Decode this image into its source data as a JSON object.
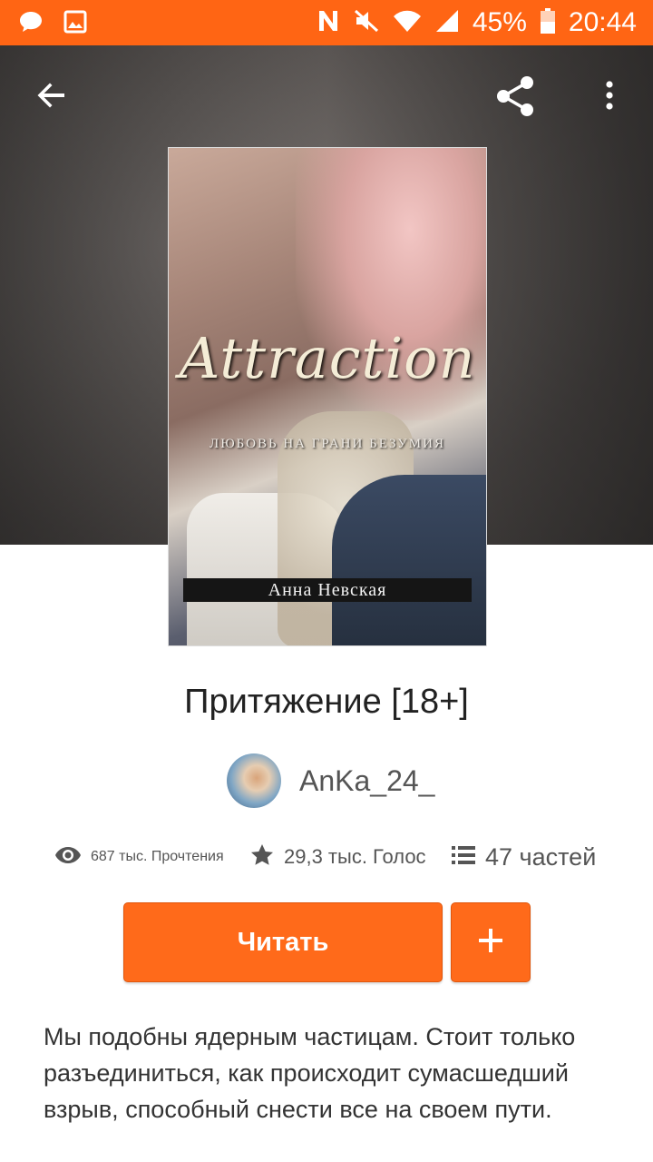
{
  "status_bar": {
    "battery": "45%",
    "time": "20:44"
  },
  "cover": {
    "title": "Attraction",
    "subtitle": "ЛЮБОВЬ НА ГРАНИ БЕЗУМИЯ",
    "author": "Анна Невская"
  },
  "story": {
    "title": "Притяжение [18+]",
    "author": "AnKa_24_",
    "views": "687 тыс. Прочтения",
    "votes": "29,3 тыс. Голос",
    "parts": "47 частей",
    "description": "Мы подобны ядерным частицам. Стоит только разъединиться, как происходит сумасшедший взрыв, способный снести все на своем пути."
  },
  "actions": {
    "read_label": "Читать",
    "add_label": "+"
  },
  "colors": {
    "accent": "#ff6514",
    "button": "#ff6a1a"
  },
  "icons": [
    "message-icon",
    "image-icon",
    "nfc-icon",
    "mute-icon",
    "wifi-icon",
    "signal-icon",
    "battery-icon",
    "back-arrow-icon",
    "share-icon",
    "more-vert-icon",
    "eye-icon",
    "star-icon",
    "list-icon",
    "plus-icon"
  ]
}
